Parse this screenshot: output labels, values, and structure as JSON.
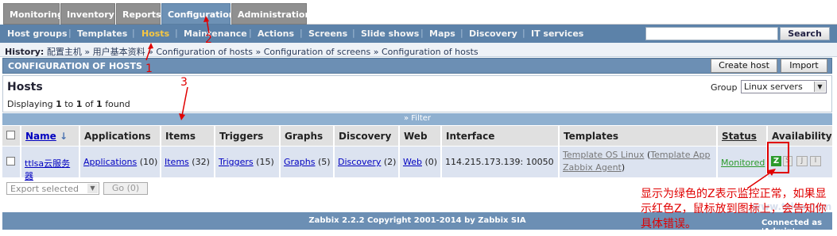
{
  "tabs": [
    "Monitoring",
    "Inventory",
    "Reports",
    "Configuration",
    "Administration"
  ],
  "subnav": [
    "Host groups",
    "Templates",
    "Hosts",
    "Maintenance",
    "Actions",
    "Screens",
    "Slide shows",
    "Maps",
    "Discovery",
    "IT services"
  ],
  "search": {
    "button": "Search",
    "value": ""
  },
  "history": {
    "label": "History:",
    "items": [
      "配置主机",
      "用户基本资料",
      "Configuration of hosts",
      "Configuration of screens",
      "Configuration of hosts"
    ]
  },
  "config_title": "CONFIGURATION OF HOSTS",
  "buttons": {
    "create_host": "Create host",
    "import": "Import"
  },
  "hosts": {
    "title": "Hosts",
    "displaying_prefix": "Displaying",
    "from": "1",
    "to_word": "to",
    "to": "1",
    "of_word": "of",
    "total": "1",
    "found_word": "found",
    "group_label": "Group",
    "group_value": "Linux servers"
  },
  "filter_label": "Filter",
  "columns": [
    "Name",
    "Applications",
    "Items",
    "Triggers",
    "Graphs",
    "Discovery",
    "Web",
    "Interface",
    "Templates",
    "Status",
    "Availability"
  ],
  "row": {
    "name": "ttlsa云服务器",
    "applications": "Applications",
    "applications_count": "(10)",
    "items": "Items",
    "items_count": "(32)",
    "triggers": "Triggers",
    "triggers_count": "(15)",
    "graphs": "Graphs",
    "graphs_count": "(5)",
    "discovery": "Discovery",
    "discovery_count": "(2)",
    "web": "Web",
    "web_count": "(0)",
    "interface": "114.215.173.139: 10050",
    "template1": "Template OS Linux",
    "template2": "Template App Zabbix Agent",
    "status": "Monitored",
    "availability": [
      "Z",
      "S",
      "J",
      "I"
    ]
  },
  "export": {
    "select": "Export selected",
    "go": "Go (0)"
  },
  "footer": {
    "copyright": "Zabbix 2.2.2 Copyright 2001-2014 by Zabbix SIA",
    "connected": "Connected as 'Admin'"
  },
  "annotations": {
    "a1": "1",
    "a2": "2",
    "a3": "3",
    "note": "显示为绿色的Z表示监控正常，如果显示红色Z，鼠标放到图标上，会告知你具体错误。"
  },
  "watermark": "www.ttlsa.com",
  "colors": {
    "accent": "#6c8fb4",
    "annotation": "#e00000",
    "ok": "#2b9a2b",
    "active_subnav": "#f6c742"
  }
}
